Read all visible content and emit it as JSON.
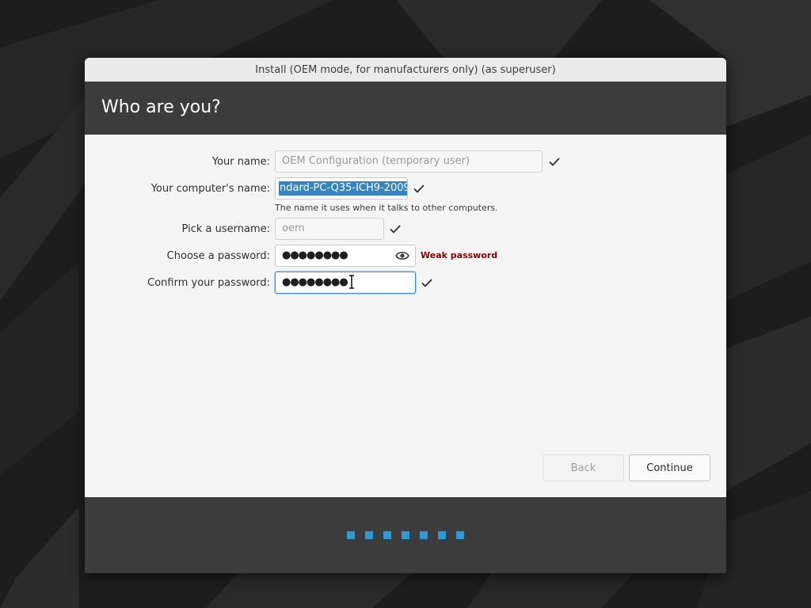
{
  "window": {
    "title": "Install (OEM mode, for manufacturers only) (as superuser)"
  },
  "page": {
    "heading": "Who are you?"
  },
  "form": {
    "name": {
      "label": "Your name:",
      "placeholder": "OEM Configuration (temporary user)"
    },
    "computer_name": {
      "label": "Your computer's name:",
      "value": "ndard-PC-Q35-ICH9-2009",
      "hint": "The name it uses when it talks to other computers."
    },
    "username": {
      "label": "Pick a username:",
      "value": "oem"
    },
    "password": {
      "label": "Choose a password:",
      "masked": "●●●●●●●●",
      "strength": "Weak password"
    },
    "confirm_password": {
      "label": "Confirm your password:",
      "masked": "●●●●●●●●"
    }
  },
  "buttons": {
    "back": "Back",
    "continue": "Continue"
  },
  "progress": {
    "total_steps": 7
  },
  "colors": {
    "accent": "#3584c6",
    "progress": "#2a9ad8",
    "header_bg": "#3c3c3c",
    "warning": "#8b0000"
  },
  "icons": {
    "valid": "checkmark-icon",
    "reveal": "eye-icon",
    "cursor": "text-cursor-icon"
  }
}
